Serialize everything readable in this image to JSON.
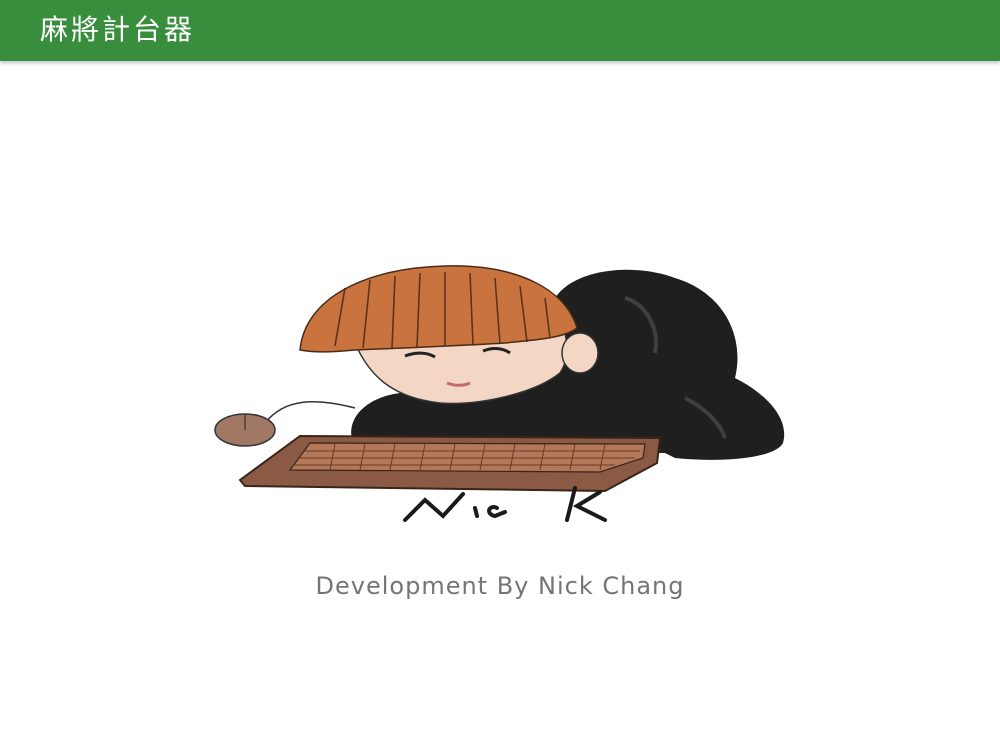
{
  "app_bar": {
    "title": "麻將計台器",
    "color": "#388e3c"
  },
  "illustration": {
    "icon": "developer-portrait-illustration",
    "signature": "Nick"
  },
  "credit": {
    "text": "Development By Nick Chang",
    "color": "#757575"
  }
}
